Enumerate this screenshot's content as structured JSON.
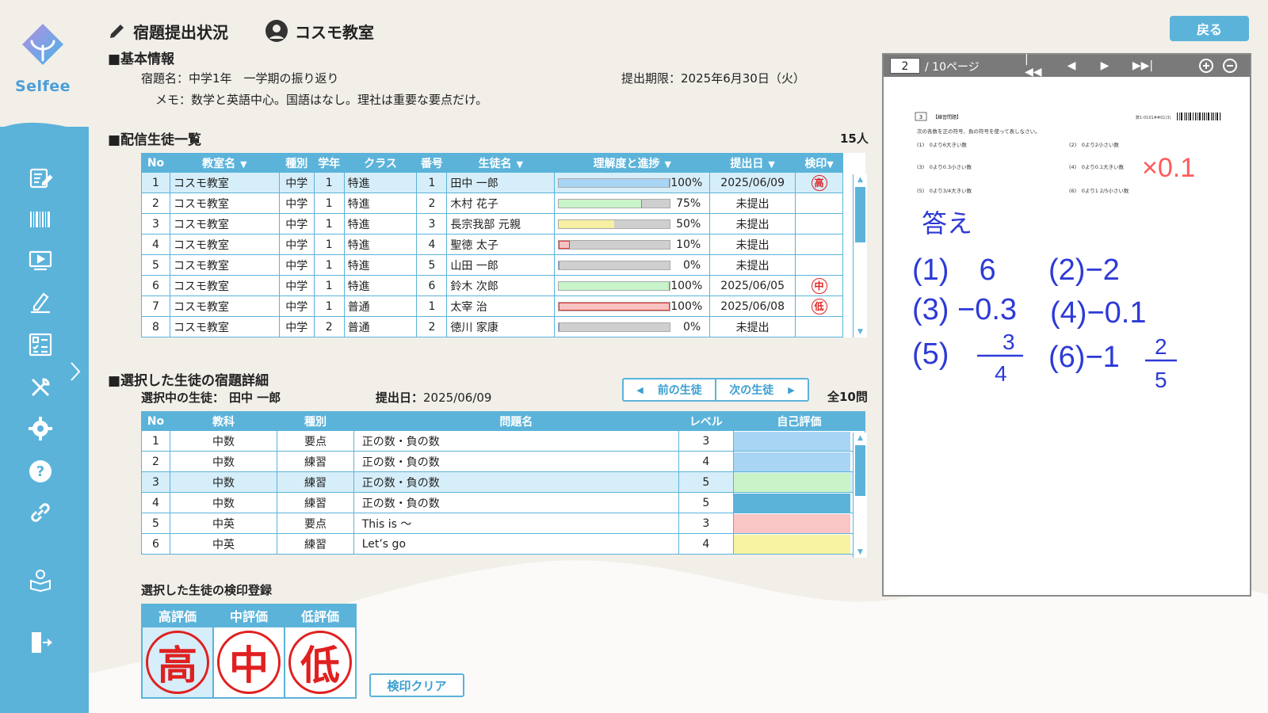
{
  "brand": {
    "name": "Selfee"
  },
  "header": {
    "title": "宿題提出状況",
    "classroom": "コスモ教室",
    "back_label": "戻る"
  },
  "basic_info": {
    "heading": "■基本情報",
    "homework_label": "宿題名：",
    "homework_name": "中学1年　一学期の振り返り",
    "deadline_label": "提出期限：",
    "deadline": "2025年6月30日（火）",
    "memo_label": "メモ：",
    "memo": "数学と英語中心。国語はなし。理社は重要な要点だけ。"
  },
  "students": {
    "heading": "■配信生徒一覧",
    "count": "15人",
    "columns": [
      "No",
      "教室名",
      "種別",
      "学年",
      "クラス",
      "番号",
      "生徒名",
      "理解度と進捗",
      "提出日",
      "検印"
    ],
    "rows": [
      {
        "no": "1",
        "room": "コスモ教室",
        "type": "中学",
        "grade": "1",
        "class": "特進",
        "num": "1",
        "name": "田中 一郎",
        "progress": 1.0,
        "pct": "100%",
        "bar": "blue",
        "date": "2025/06/09",
        "stamp": "高",
        "selected": true
      },
      {
        "no": "2",
        "room": "コスモ教室",
        "type": "中学",
        "grade": "1",
        "class": "特進",
        "num": "2",
        "name": "木村 花子",
        "progress": 0.75,
        "pct": "75%",
        "bar": "green",
        "date": "未提出",
        "stamp": ""
      },
      {
        "no": "3",
        "room": "コスモ教室",
        "type": "中学",
        "grade": "1",
        "class": "特進",
        "num": "3",
        "name": "長宗我部 元親",
        "progress": 0.5,
        "pct": "50%",
        "bar": "yellow",
        "date": "未提出",
        "stamp": ""
      },
      {
        "no": "4",
        "room": "コスモ教室",
        "type": "中学",
        "grade": "1",
        "class": "特進",
        "num": "4",
        "name": "聖徳 太子",
        "progress": 0.1,
        "pct": "10%",
        "bar": "red",
        "date": "未提出",
        "stamp": ""
      },
      {
        "no": "5",
        "room": "コスモ教室",
        "type": "中学",
        "grade": "1",
        "class": "特進",
        "num": "5",
        "name": "山田 一郎",
        "progress": 0,
        "pct": "0%",
        "bar": "blue",
        "date": "未提出",
        "stamp": ""
      },
      {
        "no": "6",
        "room": "コスモ教室",
        "type": "中学",
        "grade": "1",
        "class": "特進",
        "num": "6",
        "name": "鈴木 次郎",
        "progress": 1.0,
        "pct": "100%",
        "bar": "green",
        "date": "2025/06/05",
        "stamp": "中"
      },
      {
        "no": "7",
        "room": "コスモ教室",
        "type": "中学",
        "grade": "1",
        "class": "普通",
        "num": "1",
        "name": "太宰 治",
        "progress": 1.0,
        "pct": "100%",
        "bar": "red",
        "date": "2025/06/08",
        "stamp": "低"
      },
      {
        "no": "8",
        "room": "コスモ教室",
        "type": "中学",
        "grade": "2",
        "class": "普通",
        "num": "2",
        "name": "徳川 家康",
        "progress": 0,
        "pct": "0%",
        "bar": "blue",
        "date": "未提出",
        "stamp": ""
      }
    ]
  },
  "detail": {
    "heading": "■選択した生徒の宿題詳細",
    "selected_label": "選択中の生徒：",
    "selected_name": "田中 一郎",
    "submitted_label": "提出日：",
    "submitted_date": "2025/06/09",
    "prev_label": "前の生徒",
    "next_label": "次の生徒",
    "total": "全10問",
    "columns": [
      "No",
      "教科",
      "種別",
      "問題名",
      "レベル",
      "自己評価"
    ],
    "rows": [
      {
        "no": "1",
        "subject": "中数",
        "type": "要点",
        "name": "正の数・負の数",
        "level": "3",
        "eval_color": "#a9d5f4"
      },
      {
        "no": "2",
        "subject": "中数",
        "type": "練習",
        "name": "正の数・負の数",
        "level": "4",
        "eval_color": "#a9d5f4"
      },
      {
        "no": "3",
        "subject": "中数",
        "type": "練習",
        "name": "正の数・負の数",
        "level": "5",
        "eval_color": "#c9f3c9",
        "selected": true
      },
      {
        "no": "4",
        "subject": "中数",
        "type": "練習",
        "name": "正の数・負の数",
        "level": "5",
        "eval_color": "#5bb3da"
      },
      {
        "no": "5",
        "subject": "中英",
        "type": "要点",
        "name": "This is ～",
        "level": "3",
        "eval_color": "#f9c5c5"
      },
      {
        "no": "6",
        "subject": "中英",
        "type": "練習",
        "name": "Let’s go",
        "level": "4",
        "eval_color": "#f7f3a2"
      }
    ]
  },
  "stamp_register": {
    "heading": "選択した生徒の検印登録",
    "columns": [
      "高評価",
      "中評価",
      "低評価"
    ],
    "stamps": [
      "高",
      "中",
      "低"
    ],
    "clear_label": "検印クリア"
  },
  "viewer": {
    "page": "2",
    "total": "/ 10ページ",
    "doc": {
      "badge": "3",
      "tag": "【練習問題】",
      "code": "数1-0101##01(3)",
      "instruction": "次の各数を正の符号、負の符号を使って表しなさい。",
      "q1": "(1)　0より6大きい数",
      "q2": "(2)　0より2小さい数",
      "q3": "(3)　0より0.3小さい数",
      "q4": "(4)　0より0.1大きい数",
      "q5": "(5)　0より3/4大きい数",
      "q6": "(6)　0より1 2/5小さい数"
    },
    "handwriting": {
      "mark": "×0.1",
      "answer_label": "答え",
      "a1": "(1)　6",
      "a2": "(2)−2",
      "a3": "(3) −0.3",
      "a4": "(4)−0.1",
      "a5_prefix": "(5)",
      "a5_num": "3",
      "a5_den": "4",
      "a6_prefix": "(6)−1",
      "a6_num": "2",
      "a6_den": "5"
    }
  },
  "colors": {
    "accent": "#5bb3da",
    "background": "#f2efe9",
    "stamp": "#e02020",
    "ink": "#2d3ad6"
  }
}
